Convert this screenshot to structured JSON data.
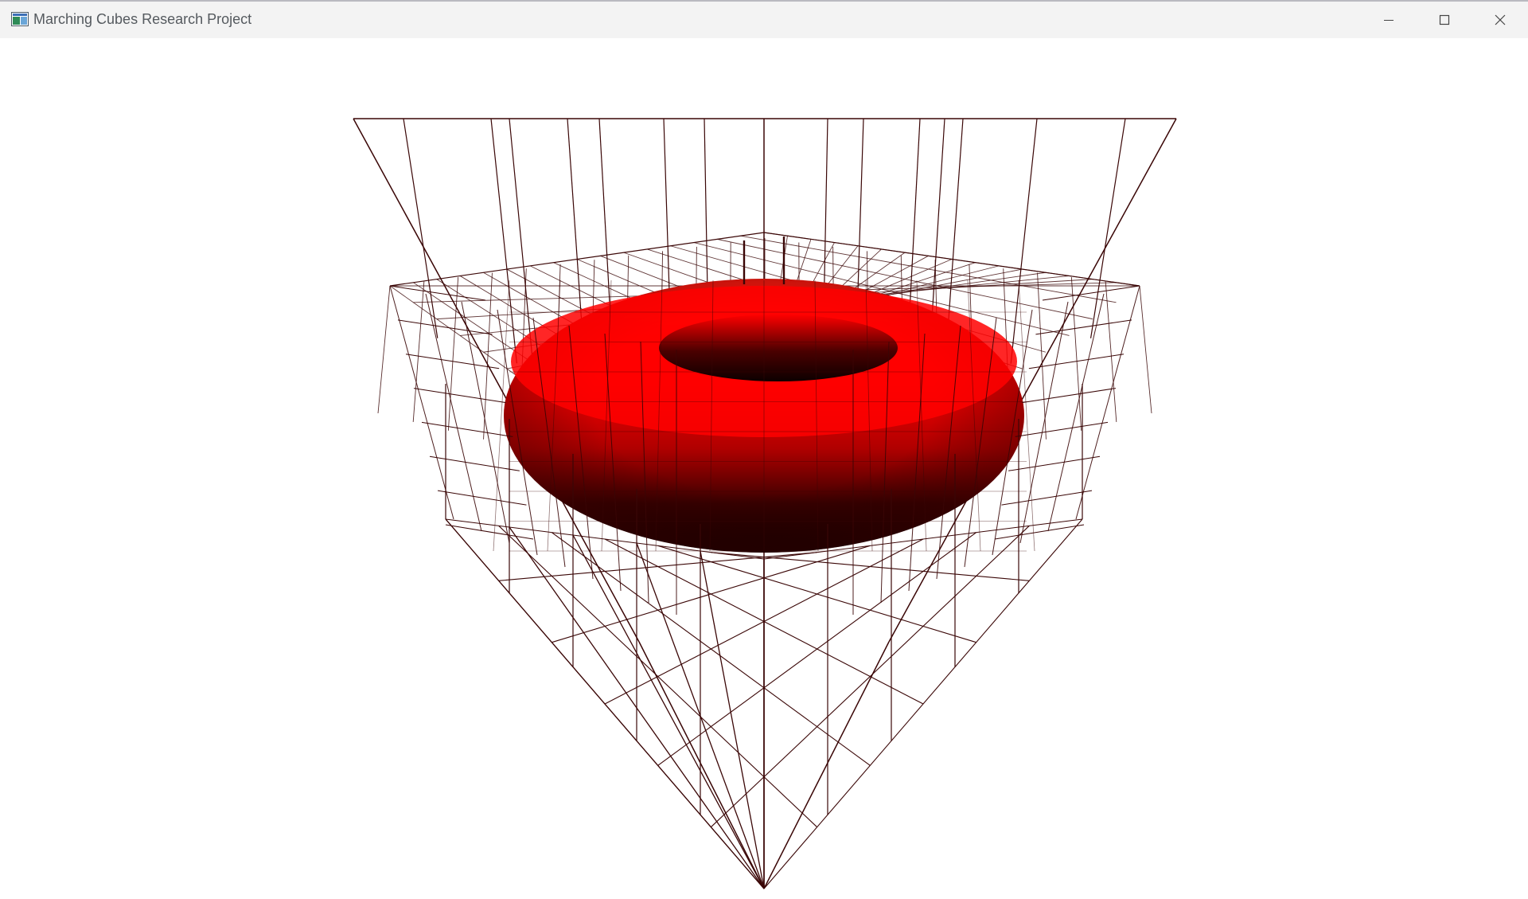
{
  "window": {
    "title": "Marching Cubes Research Project"
  },
  "titlebar": {
    "icons": {
      "app": "app-window-icon",
      "minimize": "minimize-icon",
      "maximize": "maximize-icon",
      "close": "close-icon"
    }
  },
  "scene": {
    "surface": "torus",
    "surface_color": "#ff0000",
    "wireframe_color": "#3a0606",
    "background_color": "#ffffff"
  }
}
